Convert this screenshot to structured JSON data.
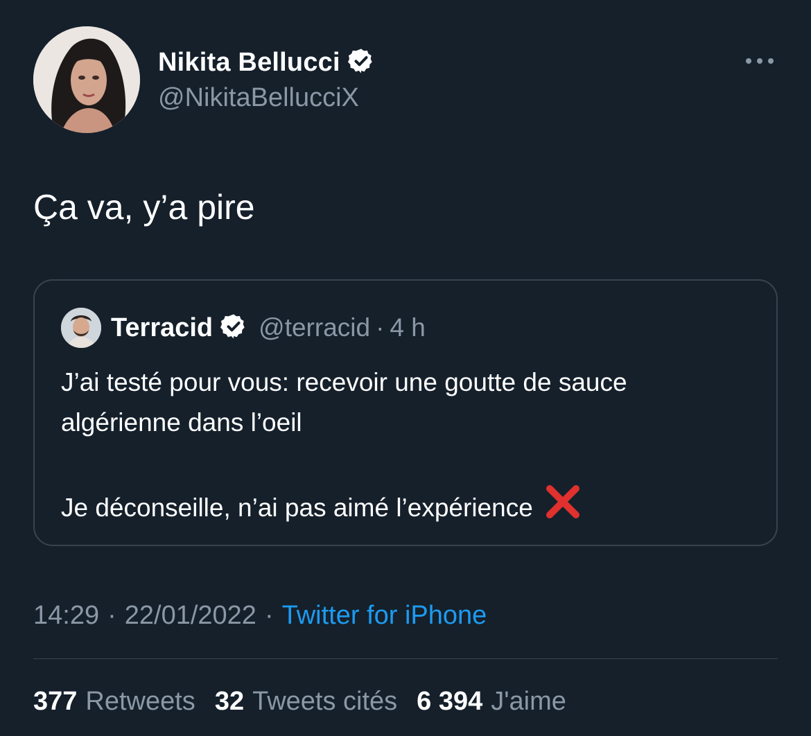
{
  "author": {
    "name": "Nikita Bellucci",
    "handle": "@NikitaBellucciX",
    "verified": true
  },
  "tweet": {
    "text": "Ça va, y’a pire"
  },
  "quoted": {
    "name": "Terracid",
    "handle": "@terracid",
    "separator": "·",
    "time": "4 h",
    "verified": true,
    "line1": "J’ai testé pour vous: recevoir une goutte de sauce",
    "line2": "algérienne dans l’oeil",
    "line3": "Je déconseille, n’ai pas aimé l’expérience",
    "emoji": "cross-mark-icon"
  },
  "meta": {
    "time": "14:29",
    "separator": "·",
    "date": "22/01/2022",
    "source": "Twitter for iPhone"
  },
  "stats": {
    "retweets_count": "377",
    "retweets_label": "Retweets",
    "quotes_count": "32",
    "quotes_label": "Tweets cités",
    "likes_count": "6 394",
    "likes_label": "J'aime"
  },
  "colors": {
    "background": "#15202b",
    "text_primary": "#ffffff",
    "text_secondary": "#8b98a5",
    "link": "#1d9bf0",
    "border": "#38444d",
    "cross": "#e0312e"
  }
}
